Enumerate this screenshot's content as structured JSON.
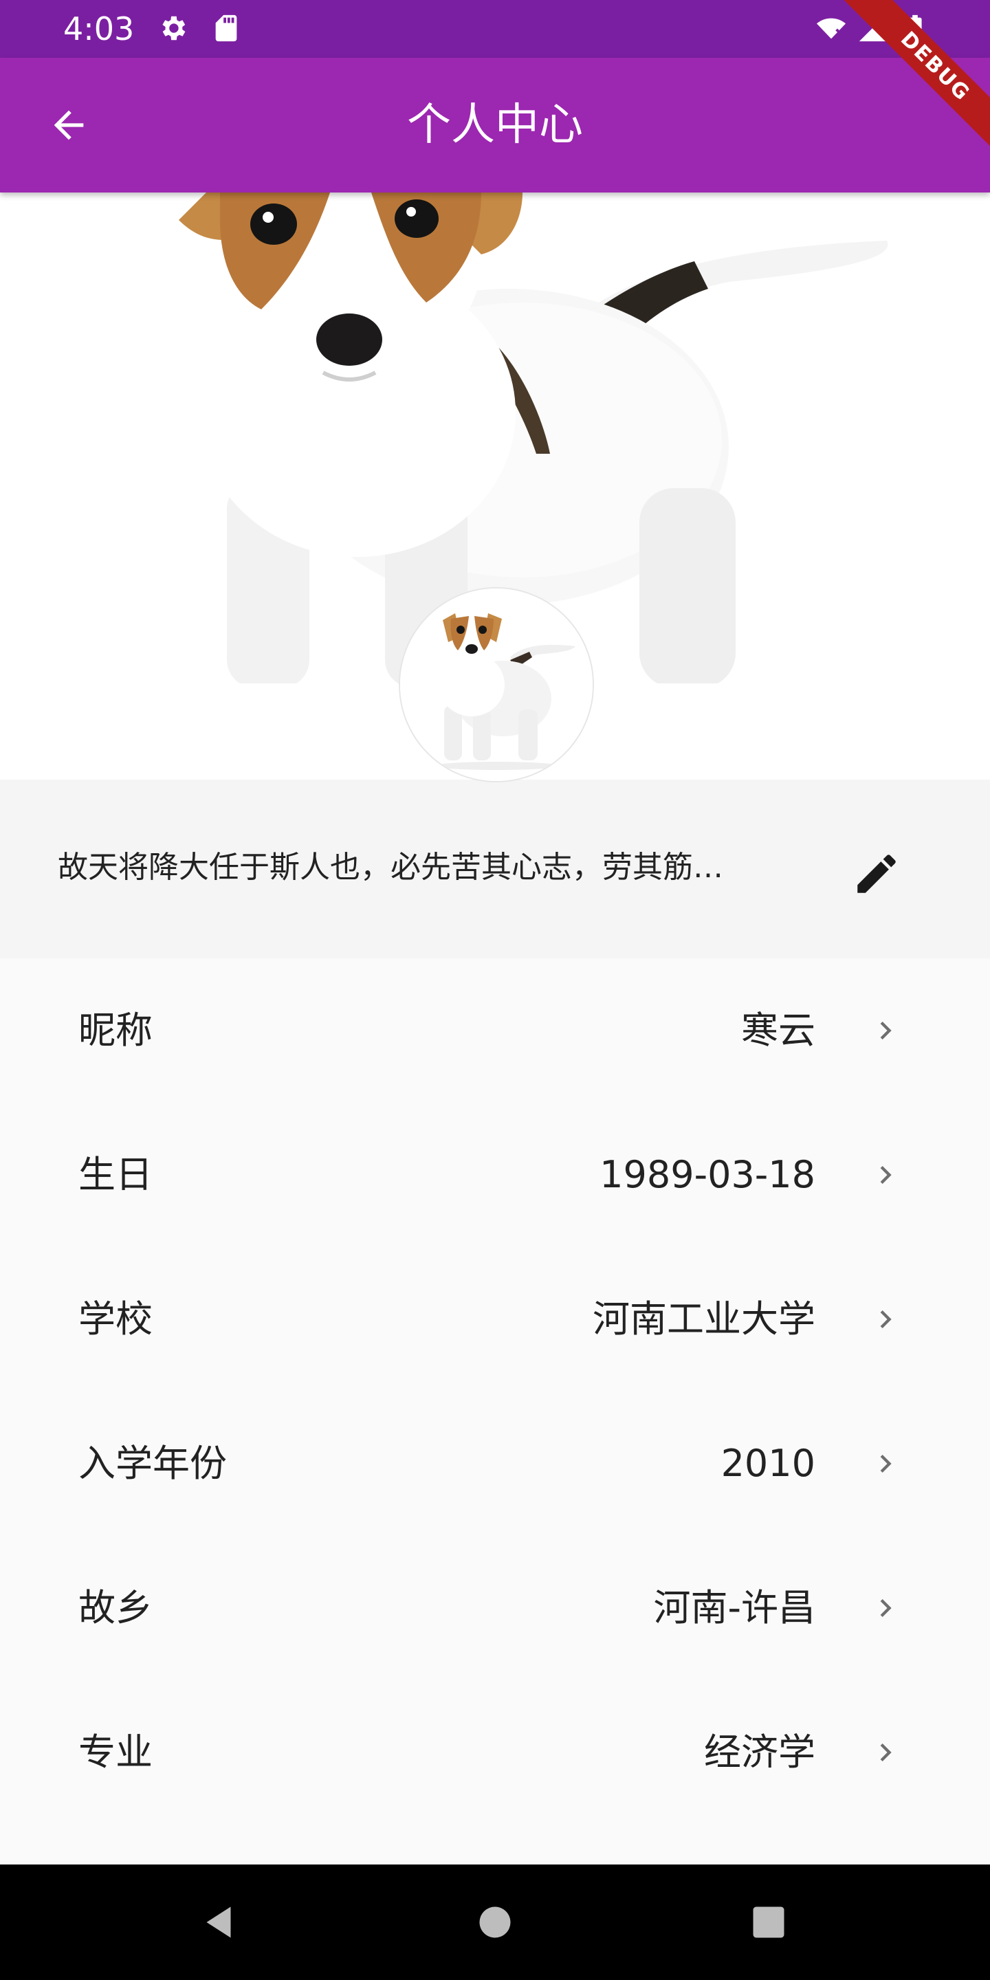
{
  "status_bar": {
    "time": "4:03",
    "icons": [
      "gear-icon",
      "sd-card-icon",
      "wifi-icon",
      "signal-icon",
      "battery-icon"
    ]
  },
  "app_bar": {
    "title": "个人中心",
    "back_icon": "arrow-back-icon",
    "color": "#9c27b0"
  },
  "debug_banner": "DEBUG",
  "profile": {
    "cover_image": "puppy-photo",
    "avatar_image": "puppy-avatar",
    "motto": "故天将降大任于斯人也，必先苦其心志，劳其筋…",
    "edit_icon": "pencil-icon"
  },
  "info": [
    {
      "label": "昵称",
      "value": "寒云"
    },
    {
      "label": "生日",
      "value": "1989-03-18"
    },
    {
      "label": "学校",
      "value": "河南工业大学"
    },
    {
      "label": "入学年份",
      "value": "2010"
    },
    {
      "label": "故乡",
      "value": "河南-许昌"
    },
    {
      "label": "专业",
      "value": "经济学"
    }
  ],
  "nav_bar": {
    "icons": [
      "back-triangle-icon",
      "home-circle-icon",
      "recents-square-icon"
    ]
  }
}
